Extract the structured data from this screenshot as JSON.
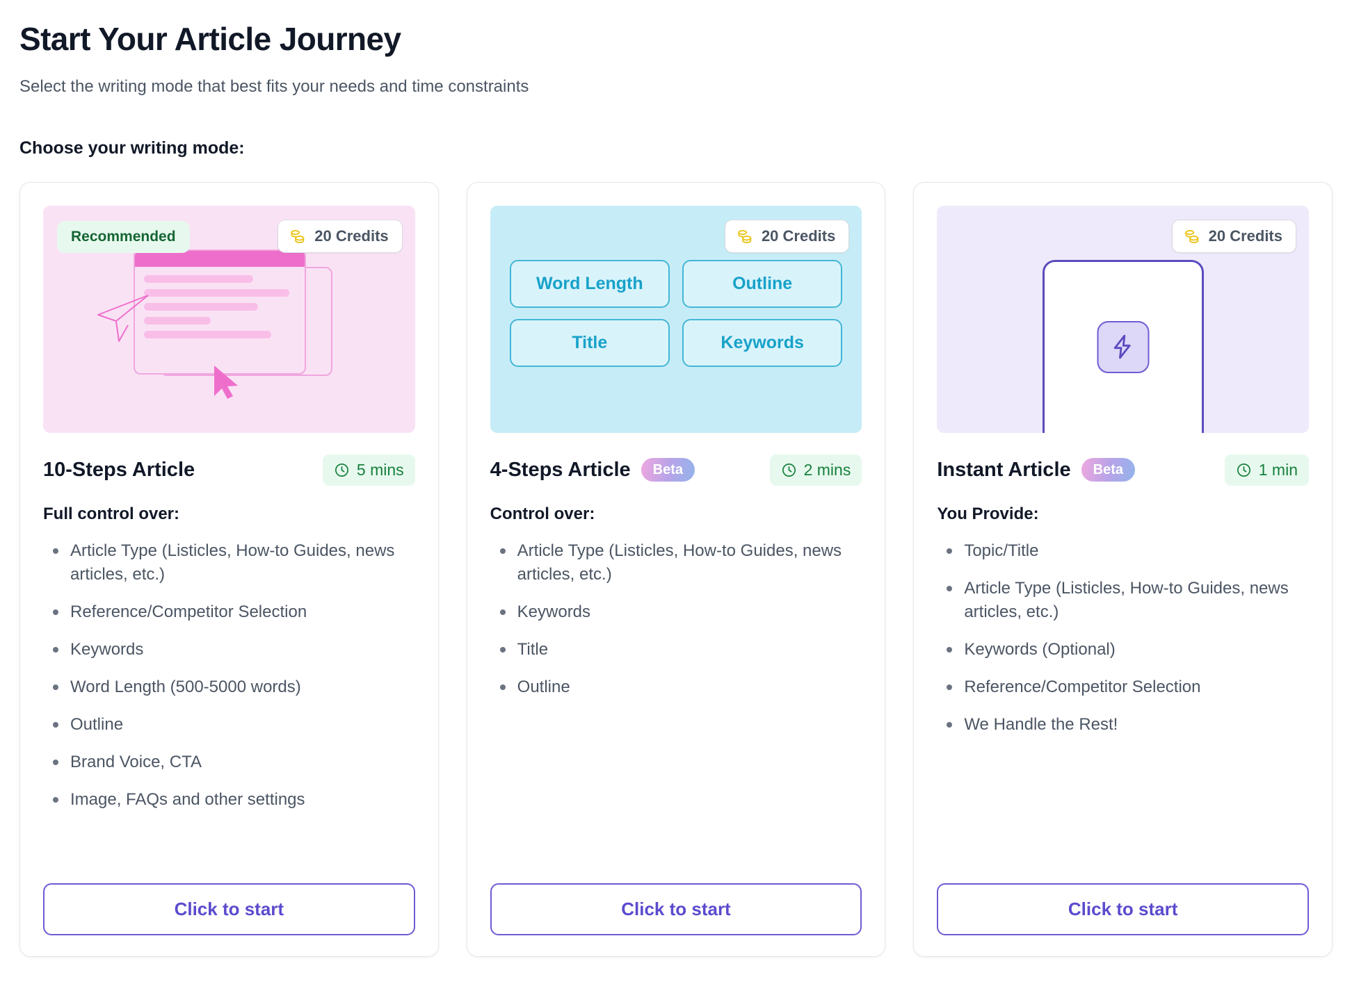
{
  "header": {
    "title": "Start Your Article Journey",
    "subtitle": "Select the writing mode that best fits your needs and time constraints",
    "section_label": "Choose your writing mode:"
  },
  "colors": {
    "accent_purple": "#6C5CD4",
    "pink_bg": "#FAE2F5",
    "cyan_bg": "#C6EDF7",
    "lavender_bg": "#EFEAFB",
    "green_badge_text": "#166534",
    "green_badge_bg": "#E7F9EE",
    "credits_coin": "#EBC61F"
  },
  "icons": {
    "coins": "coins-icon",
    "clock": "clock-icon",
    "bolt": "lightning-bolt-icon",
    "cursor": "cursor-arrow-icon",
    "plane": "paper-plane-icon"
  },
  "cards": [
    {
      "illustration": "document-editor-illustration",
      "recommended_label": "Recommended",
      "credits_label": "20 Credits",
      "title": "10-Steps Article",
      "beta_label": null,
      "time_label": "5 mins",
      "sub_label": "Full control over:",
      "features": [
        "Article Type (Listicles, How-to Guides, news articles, etc.)",
        "Reference/Competitor Selection",
        "Keywords",
        "Word Length (500-5000 words)",
        "Outline",
        "Brand Voice, CTA",
        "Image, FAQs and other settings"
      ],
      "cta_label": "Click to start"
    },
    {
      "illustration": "option-chips-illustration",
      "recommended_label": null,
      "credits_label": "20 Credits",
      "title": "4-Steps Article",
      "beta_label": "Beta",
      "time_label": "2 mins",
      "sub_label": "Control over:",
      "chips": [
        "Word Length",
        "Outline",
        "Title",
        "Keywords"
      ],
      "features": [
        "Article Type (Listicles, How-to Guides, news articles, etc.)",
        "Keywords",
        "Title",
        "Outline"
      ],
      "cta_label": "Click to start"
    },
    {
      "illustration": "instant-bolt-illustration",
      "recommended_label": null,
      "credits_label": "20 Credits",
      "title": "Instant Article",
      "beta_label": "Beta",
      "time_label": "1 min",
      "sub_label": "You Provide:",
      "features": [
        "Topic/Title",
        "Article Type (Listicles, How-to Guides, news articles, etc.)",
        "Keywords (Optional)",
        "Reference/Competitor Selection",
        "We Handle the Rest!"
      ],
      "cta_label": "Click to start"
    }
  ]
}
